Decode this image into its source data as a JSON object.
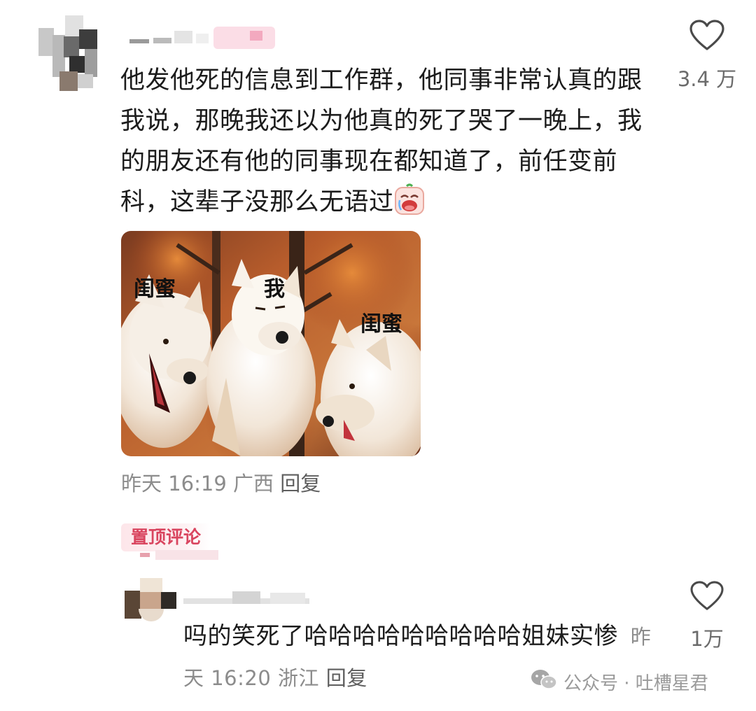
{
  "comment": {
    "text": "他发他死的信息到工作群，他同事非常认真的跟我说，那晚我还以为他真的死了哭了一晚上，我的朋友还有他的同事现在都知道了，前任变前科，这辈子没那么无语过",
    "like_count": "3.4 万",
    "meta": {
      "time": "昨天 16:19",
      "location": "广西",
      "reply_label": "回复"
    },
    "image_labels": {
      "left": "闺蜜",
      "center": "我",
      "right": "闺蜜"
    },
    "emoji": "crying-face-emoji"
  },
  "pinned_badge": "置顶评论",
  "reply": {
    "text": "吗的笑死了哈哈哈哈哈哈哈哈哈姐妹实惨",
    "like_count": "1万",
    "meta": {
      "time": "昨天 16:20",
      "location": "浙江",
      "reply_label": "回复"
    }
  },
  "watermark": {
    "text": "公众号 · 吐槽星君",
    "icon": "wechat-icon"
  },
  "colors": {
    "accent_pin": "#d9455f",
    "meta_gray": "#8c8c8c",
    "text": "#1c1c1c"
  }
}
